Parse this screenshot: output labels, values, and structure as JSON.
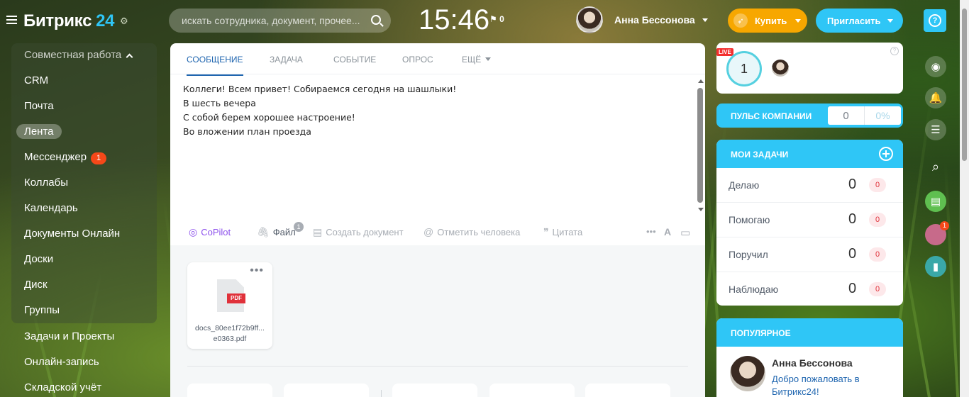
{
  "header": {
    "logo_text": "Битрикс",
    "logo_num": "24",
    "search_placeholder": "искать сотрудника, документ, прочее...",
    "clock": "15:46",
    "flag_count": "0",
    "user_name": "Анна Бессонова",
    "buy_label": "Купить",
    "invite_label": "Пригласить",
    "help_label": "?"
  },
  "menu": {
    "group_title": "Совместная работа",
    "items": [
      "CRM",
      "Почта",
      "Лента",
      "Мессенджер",
      "Коллабы",
      "Календарь",
      "Документы Онлайн",
      "Доски",
      "Диск",
      "Группы",
      "Задачи и Проекты",
      "Онлайн-запись",
      "Складской учёт"
    ],
    "messenger_badge": "1"
  },
  "composer": {
    "tabs": [
      "СООБЩЕНИЕ",
      "ЗАДАЧА",
      "СОБЫТИЕ",
      "ОПРОС",
      "ЕЩЁ"
    ],
    "message_lines": [
      "Коллеги! Всем привет! Собираемся сегодня на шашлыки!",
      "В шесть вечера",
      "С собой берем хорошее настроение!",
      "Во вложении план проезда"
    ],
    "toolbar": {
      "copilot": "CoPilot",
      "file": "Файл",
      "file_count": "1",
      "create_doc": "Создать документ",
      "mention": "Отметить человека",
      "quote": "Цитата"
    }
  },
  "attachment": {
    "type_label": "PDF",
    "name_line1": "docs_80ee1f72b9ff...",
    "name_line2": "e0363.pdf"
  },
  "live": {
    "tag": "LIVE",
    "count": "1"
  },
  "pulse": {
    "label": "ПУЛЬС КОМПАНИИ",
    "value": "0",
    "percent": "0%"
  },
  "tasks": {
    "title": "МОИ ЗАДАЧИ",
    "rows": [
      {
        "label": "Делаю",
        "count": "0",
        "badge": "0"
      },
      {
        "label": "Помогаю",
        "count": "0",
        "badge": "0"
      },
      {
        "label": "Поручил",
        "count": "0",
        "badge": "0"
      },
      {
        "label": "Наблюдаю",
        "count": "0",
        "badge": "0"
      }
    ]
  },
  "popular": {
    "title": "ПОПУЛЯРНОЕ",
    "author": "Анна Бессонова",
    "text": "Добро пожаловать в Битрикс24!"
  },
  "right_bar": {
    "chat_badge": "1"
  },
  "colors": {
    "accent": "#2fc6f6",
    "buy": "#f7a700",
    "badge": "#f54819",
    "link": "#2066b0"
  }
}
